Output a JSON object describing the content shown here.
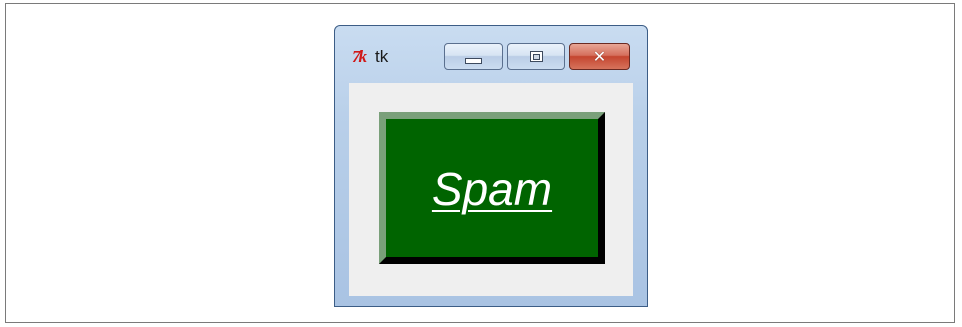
{
  "window": {
    "title": "tk",
    "icon": "tk-feather-icon",
    "icon_label": "7k"
  },
  "titlebar_buttons": {
    "minimize_icon": "minimize-icon",
    "maximize_icon": "maximize-icon",
    "close_icon": "close-icon",
    "close_glyph": "✕"
  },
  "main_button": {
    "label": "Spam",
    "background": "#006400",
    "text_color": "#ffffff"
  }
}
